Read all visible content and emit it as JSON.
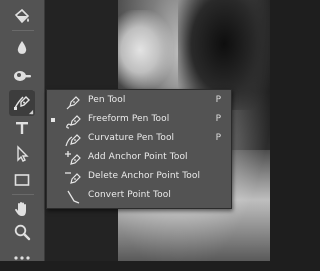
{
  "toolbar": {
    "tools": [
      {
        "name": "paint-bucket-icon"
      },
      {
        "name": "blur-drop-icon"
      },
      {
        "name": "dodge-icon"
      },
      {
        "name": "pen-tool-icon",
        "active": true
      },
      {
        "name": "type-tool-icon",
        "label": "T"
      },
      {
        "name": "path-selection-icon"
      },
      {
        "name": "rectangle-tool-icon"
      },
      {
        "name": "hand-tool-icon"
      },
      {
        "name": "zoom-tool-icon"
      },
      {
        "name": "more-tools-icon",
        "label": "•••"
      }
    ]
  },
  "flyout": {
    "items": [
      {
        "label": "Pen Tool",
        "shortcut": "P",
        "icon": "pen-icon",
        "selected": false
      },
      {
        "label": "Freeform Pen Tool",
        "shortcut": "P",
        "icon": "freeform-pen-icon",
        "selected": true
      },
      {
        "label": "Curvature Pen Tool",
        "shortcut": "P",
        "icon": "curvature-pen-icon",
        "selected": false
      },
      {
        "label": "Add Anchor Point Tool",
        "shortcut": "",
        "icon": "add-anchor-icon",
        "selected": false
      },
      {
        "label": "Delete Anchor Point Tool",
        "shortcut": "",
        "icon": "delete-anchor-icon",
        "selected": false
      },
      {
        "label": "Convert Point Tool",
        "shortcut": "",
        "icon": "convert-point-icon",
        "selected": false
      }
    ]
  },
  "colors": {
    "toolbar_bg": "#535353",
    "flyout_bg": "#535353",
    "text": "#ececec"
  }
}
